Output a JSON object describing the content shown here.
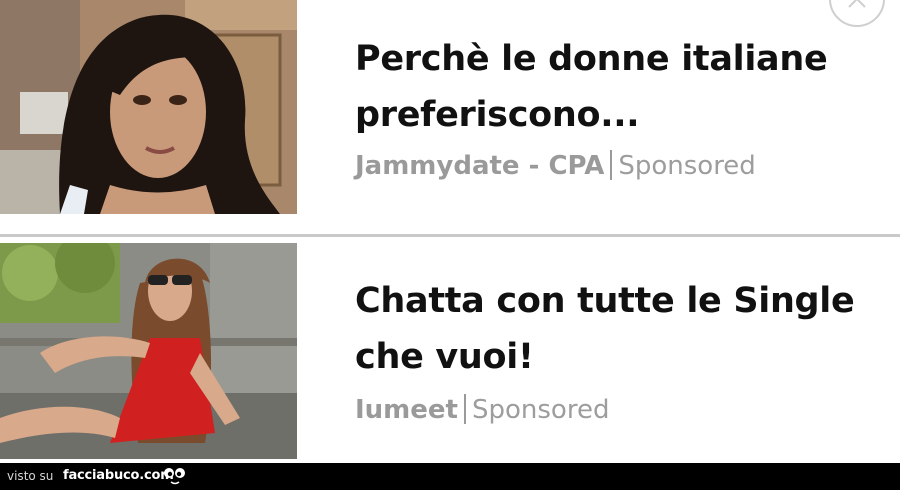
{
  "ads": [
    {
      "headline": "Perchè le donne italiane preferiscono...",
      "source": "Jammydate - CPA",
      "label": "Sponsored"
    },
    {
      "headline": "Chatta con tutte le Single che vuoi!",
      "source": "Iumeet",
      "label": "Sponsored"
    }
  ],
  "close_icon": "close-icon",
  "footer": {
    "prefix": "visto su",
    "site": "facciabuco.com",
    "logo_icon": "eyes-logo-icon"
  },
  "colors": {
    "headline": "#111111",
    "meta": "#9a9a9a",
    "separator": "#c9c9c9",
    "footer_bg": "#000000"
  }
}
